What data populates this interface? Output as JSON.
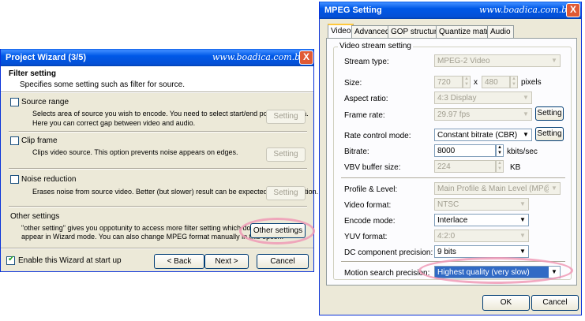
{
  "wizard": {
    "title": "Project Wizard (3/5)",
    "site": "www.boadica.com.br",
    "close": "X",
    "header_title": "Filter setting",
    "header_subtitle": "Specifies some setting such as filter for source.",
    "source_range": {
      "label": "Source range",
      "desc1": "Selects area of source you wish to encode. You need to select start/end point as a area.",
      "desc2": "Here you can correct gap between video and audio.",
      "button": "Setting"
    },
    "clip_frame": {
      "label": "Clip frame",
      "desc1": "Clips video source. This option prevents noise appears on edges.",
      "button": "Setting"
    },
    "noise_reduction": {
      "label": "Noise reduction",
      "desc1": "Erases noise from source video. Better (but slower) result can be expected with this option.",
      "button": "Setting"
    },
    "other_settings": {
      "label": "Other settings",
      "desc1": "\"other setting\" gives you oppotunity to access more filter setting which do not",
      "desc2": "appear in Wizard mode. You can also change MPEG format manually in this option.",
      "button": "Other settings"
    },
    "enable_label": "Enable this Wizard at start up",
    "back": "< Back",
    "next": "Next >",
    "cancel": "Cancel"
  },
  "mpeg": {
    "title": "MPEG Setting",
    "site": "www.boadica.com.br",
    "close": "X",
    "tabs": [
      "Video",
      "Advanced",
      "GOP structure",
      "Quantize matrix",
      "Audio"
    ],
    "group_label": "Video stream setting",
    "stream_type": {
      "label": "Stream type:",
      "value": "MPEG-2 Video"
    },
    "size": {
      "label": "Size:",
      "w": "720",
      "x": "x",
      "h": "480",
      "unit": "pixels"
    },
    "aspect": {
      "label": "Aspect ratio:",
      "value": "4:3 Display"
    },
    "frame_rate": {
      "label": "Frame rate:",
      "value": "29.97 fps",
      "button": "Setting"
    },
    "rate_control": {
      "label": "Rate control mode:",
      "value": "Constant bitrate (CBR)",
      "button": "Setting"
    },
    "bitrate": {
      "label": "Bitrate:",
      "value": "8000",
      "unit": "kbits/sec"
    },
    "vbv": {
      "label": "VBV buffer size:",
      "value": "224",
      "unit": "KB"
    },
    "profile": {
      "label": "Profile & Level:",
      "value": "Main Profile & Main Level (MP@ML)"
    },
    "video_format": {
      "label": "Video format:",
      "value": "NTSC"
    },
    "encode_mode": {
      "label": "Encode mode:",
      "value": "Interlace"
    },
    "yuv": {
      "label": "YUV format:",
      "value": "4:2:0"
    },
    "dc": {
      "label": "DC component precision:",
      "value": "9 bits"
    },
    "motion": {
      "label": "Motion search precision:",
      "value": "Highest quality (very slow)"
    },
    "ok": "OK",
    "cancel": "Cancel"
  }
}
